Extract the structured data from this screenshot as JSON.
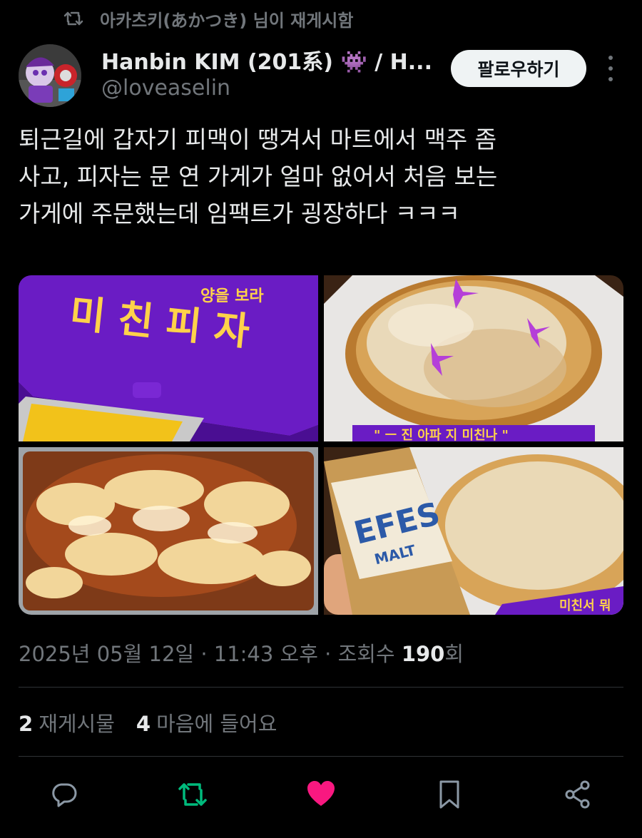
{
  "repost": {
    "text": "아카츠키(あかつき) 님이 재게시함",
    "icon": "repost-icon"
  },
  "author": {
    "display_name": "Hanbin KIM (201系) 👾 / H...",
    "handle": "@loveaselin",
    "follow_label": "팔로우하기"
  },
  "tweet": {
    "lines": [
      "퇴근길에 갑자기 피맥이 땡겨서 마트에서 맥주 좀",
      "사고, 피자는 문 연 가게가 얼마 없어서 처음 보는",
      "가게에 주문했는데 임팩트가 굉장하다 ㅋㅋㅋ"
    ]
  },
  "media": {
    "box_text_top": "양을 보라",
    "box_title": "미친피자",
    "banner_text": "\" ㅡ 진 아파 지 미친나 \"",
    "can_brand": "EFES",
    "can_sub": "MALT",
    "banner_text_2": "미친서 뭐"
  },
  "meta": {
    "date": "2025년 05월 12일",
    "time": "11:43 오후",
    "views_label": "조회수",
    "views_count": "190",
    "views_suffix": "회"
  },
  "stats": {
    "reposts_count": "2",
    "reposts_label": "재게시물",
    "likes_count": "4",
    "likes_label": "마음에 들어요"
  },
  "actions": {
    "reply": "reply-icon",
    "repost": "repost-icon",
    "like": "heart-icon",
    "bookmark": "bookmark-icon",
    "share": "share-icon"
  },
  "colors": {
    "background": "#000000",
    "text": "#e7e9ea",
    "secondary": "#71767b",
    "repost_active": "#00ba7c",
    "like_active": "#f91880",
    "box_purple": "#6a1cc4",
    "box_yellow": "#ffd24a"
  }
}
